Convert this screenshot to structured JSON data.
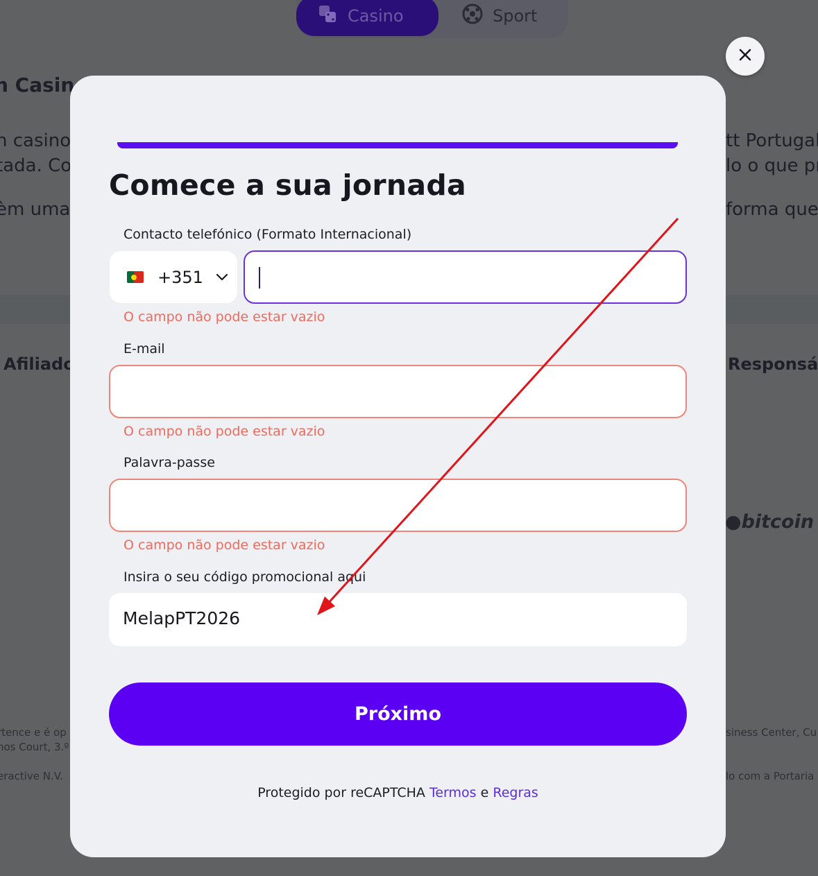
{
  "background": {
    "nav": {
      "casino": "Casino",
      "sport": "Sport"
    },
    "texts": {
      "heading_left": "n Casino",
      "line1_left": "n casino",
      "line2_left": "tada. Co",
      "line3_left": "èm uma",
      "line1_right": "tt Portugal",
      "line2_right": "lo o que pre",
      "line3_right": "forma que",
      "affiliates": "Afiliados",
      "responsible": "Responsáv",
      "bitcoin": "bitcoin",
      "foot1_left": "rtence e é op",
      "foot2_left": "nos Court, 3.º",
      "foot3_left": "eractive N.V.",
      "foot1_right": "siness Center, Cu",
      "foot3_right": "lo com a Portaria"
    }
  },
  "modal": {
    "title": "Comece a sua jornada",
    "phone": {
      "label": "Contacto telefónico (Formato Internacional)",
      "country_code": "+351",
      "value": "",
      "error": "O campo não pode estar vazio"
    },
    "email": {
      "label": "E-mail",
      "value": "",
      "error": "O campo não pode estar vazio"
    },
    "password": {
      "label": "Palavra-passe",
      "value": "",
      "error": "O campo não pode estar vazio"
    },
    "promo": {
      "label": "Insira o seu código promocional aqui",
      "value": "MelapPT2026"
    },
    "submit_label": "Próximo",
    "recaptcha": {
      "prefix": "Protegido por reCAPTCHA",
      "terms": "Termos",
      "and": "e",
      "rules": "Regras"
    }
  },
  "colors": {
    "accent": "#5b00f2",
    "error": "#f06a5e",
    "annotation_arrow": "#e0141b"
  }
}
